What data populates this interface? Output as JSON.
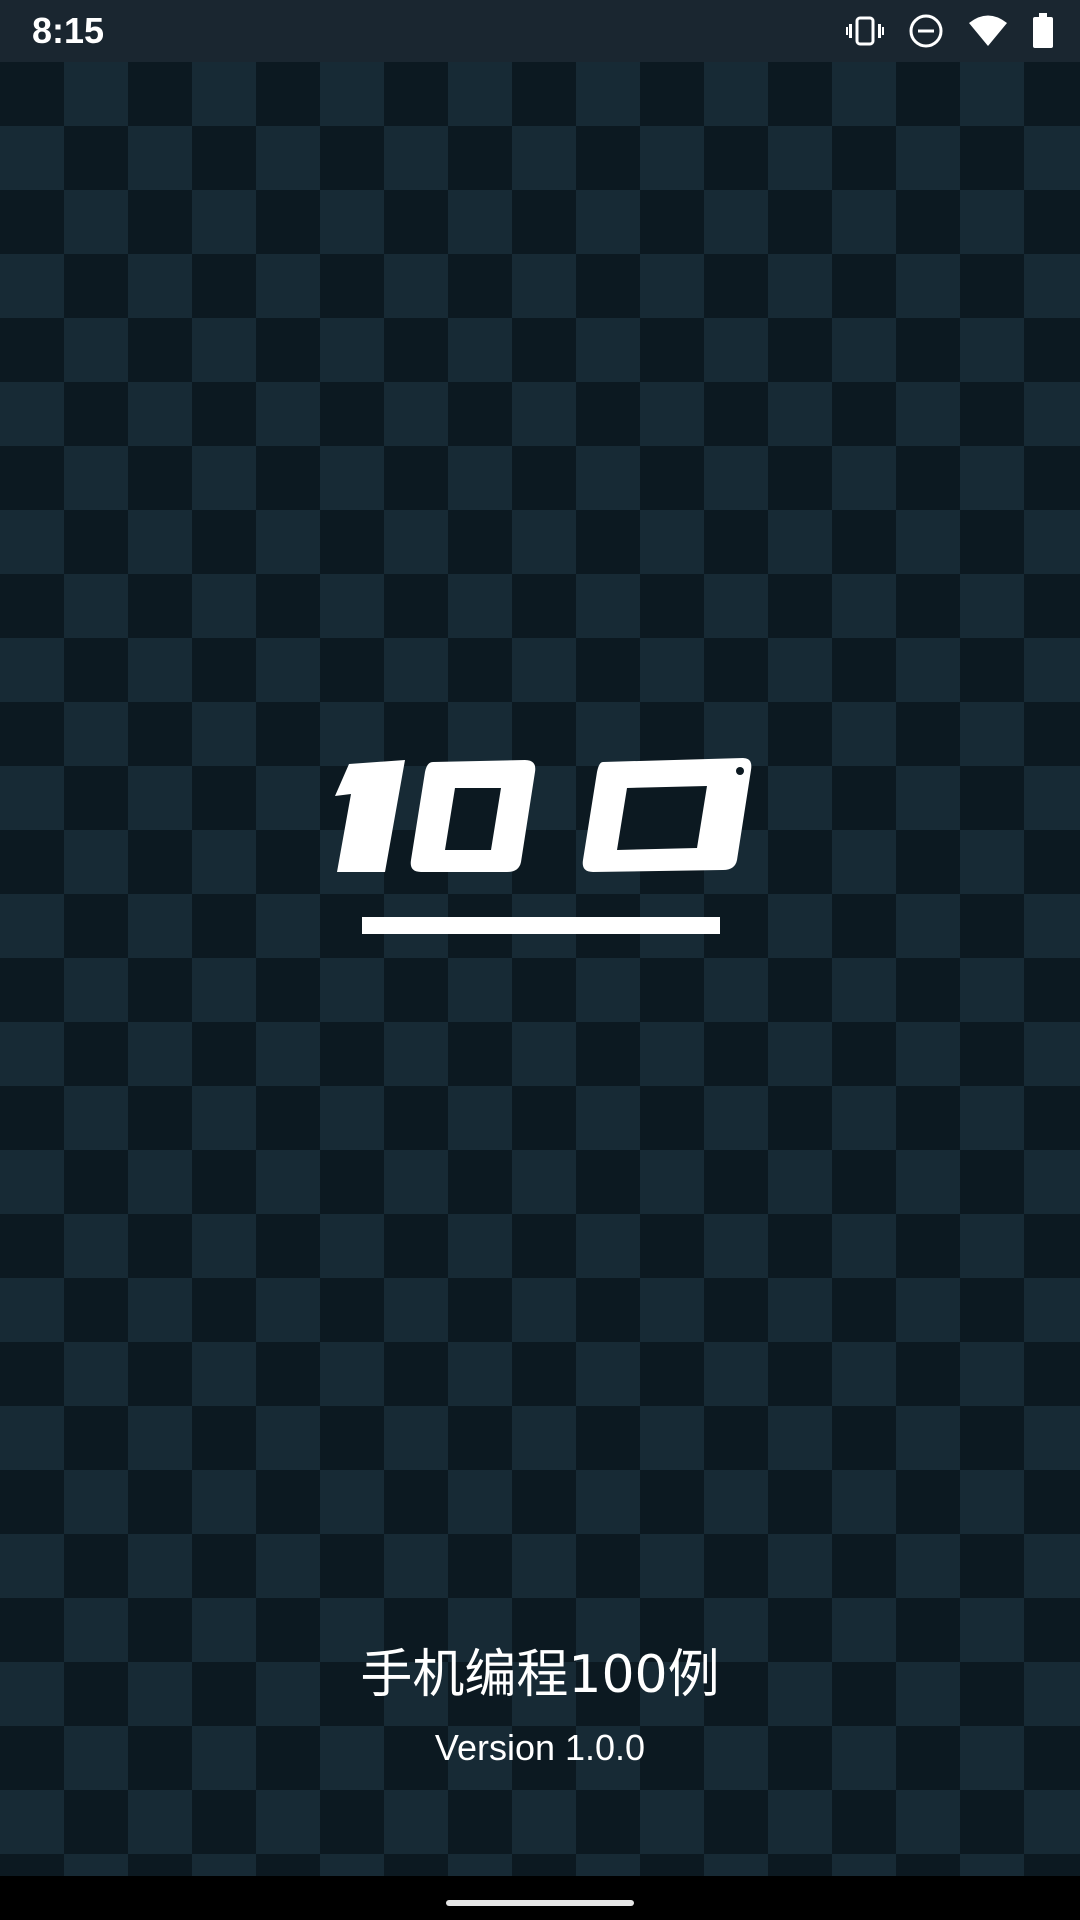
{
  "status_bar": {
    "time": "8:15",
    "icons": [
      "vibrate-icon",
      "do-not-disturb-icon",
      "wifi-icon",
      "battery-icon"
    ]
  },
  "logo": {
    "icon": "app-logo-100"
  },
  "app": {
    "name": "手机编程100例",
    "version": "Version 1.0.0"
  },
  "colors": {
    "background_dark": "#0c1921",
    "background_light": "#172a35",
    "status_bar": "#1a2630",
    "text": "#ffffff",
    "nav_bar": "#000000"
  }
}
